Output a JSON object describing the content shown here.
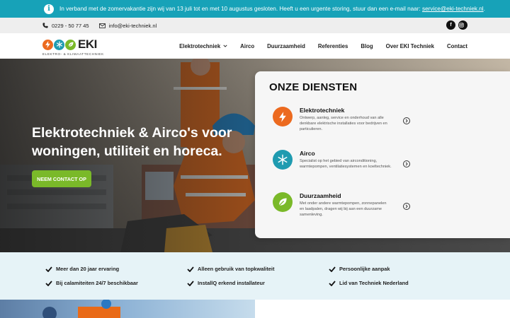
{
  "notice": {
    "text": "In verband met de zomervakantie zijn wij van 13 juli tot en met 10 augustus gesloten. Heeft u een urgente storing, stuur dan een e-mail naar:",
    "email": "service@eki-techniek.nl",
    "end": "."
  },
  "topbar": {
    "phone": "0229 - 50 77 45",
    "email": "info@eki-techniek.nl",
    "socials": [
      "facebook-icon",
      "instagram-icon"
    ]
  },
  "logo": {
    "text": "EKI",
    "sub": "ELEKTRO- & KLIMAATTECHNIEK"
  },
  "nav": {
    "items": [
      "Elektrotechniek",
      "Airco",
      "Duurzaamheid",
      "Referenties",
      "Blog",
      "Over EKI Techniek",
      "Contact"
    ]
  },
  "hero": {
    "title": "Elektrotechniek & Airco's voor woningen, utiliteit en horeca.",
    "button": "NEEM CONTACT OP"
  },
  "services": {
    "title": "ONZE DIENSTEN",
    "items": [
      {
        "title": "Elektrotechniek",
        "desc": "Ontwerp, aanleg, service en onderhoud van alle denkbare elektrische installaties voor bedrijven en particulieren.",
        "icon": "lightning-icon",
        "color": "#ec6a1f"
      },
      {
        "title": "Airco",
        "desc": "Specialist op het gebied van airconditioning, warmtepompen, ventilatiesystemen en koeltechniek.",
        "icon": "snowflake-icon",
        "color": "#1f9bb0"
      },
      {
        "title": "Duurzaamheid",
        "desc": "Met onder andere warmtepompen, zonnepanelen en laadpalen, dragen wij bij aan een duurzame samenleving.",
        "icon": "leaf-icon",
        "color": "#7ab929"
      }
    ]
  },
  "usps": [
    "Meer dan 20 jaar ervaring",
    "Alleen gebruik van topkwaliteit",
    "Persoonlijke aanpak",
    "Bij calamiteiten 24/7 beschikbaar",
    "InstallQ erkend installateur",
    "Lid van Techniek Nederland"
  ],
  "colors": {
    "notice": "#17a2b8",
    "accent_green": "#7ab929",
    "accent_orange": "#ec6a1f",
    "accent_teal": "#1f9bb0"
  }
}
